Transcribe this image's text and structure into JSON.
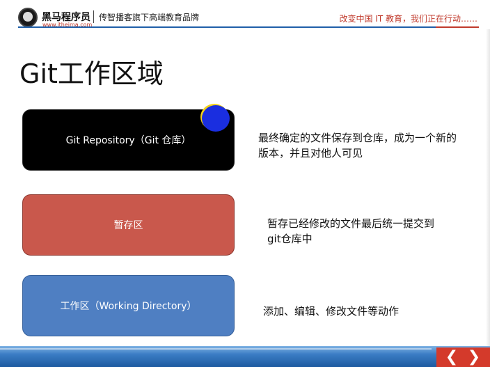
{
  "header": {
    "brand_name": "黑马程序员",
    "brand_url": "www.itheima.com",
    "tagline": "传智播客旗下高端教育品牌",
    "slogan": "改变中国 IT 教育，我们正在行动……"
  },
  "slide": {
    "title": "Git工作区域",
    "areas": [
      {
        "label": "Git Repository（Git 仓库）",
        "description": "最终确定的文件保存到仓库，成为一个新的版本，并且对他人可见",
        "color": "#000000"
      },
      {
        "label": "暂存区",
        "description": "暂存已经修改的文件最后统一提交到git仓库中",
        "color": "#c9584c"
      },
      {
        "label": "工作区（Working Directory）",
        "description": "添加、编辑、修改文件等动作",
        "color": "#4f7fc2"
      }
    ]
  },
  "navigation": {
    "prev_icon": "chevron-left-icon",
    "next_icon": "chevron-right-icon",
    "prev_glyph": "❮",
    "next_glyph": "❯"
  }
}
